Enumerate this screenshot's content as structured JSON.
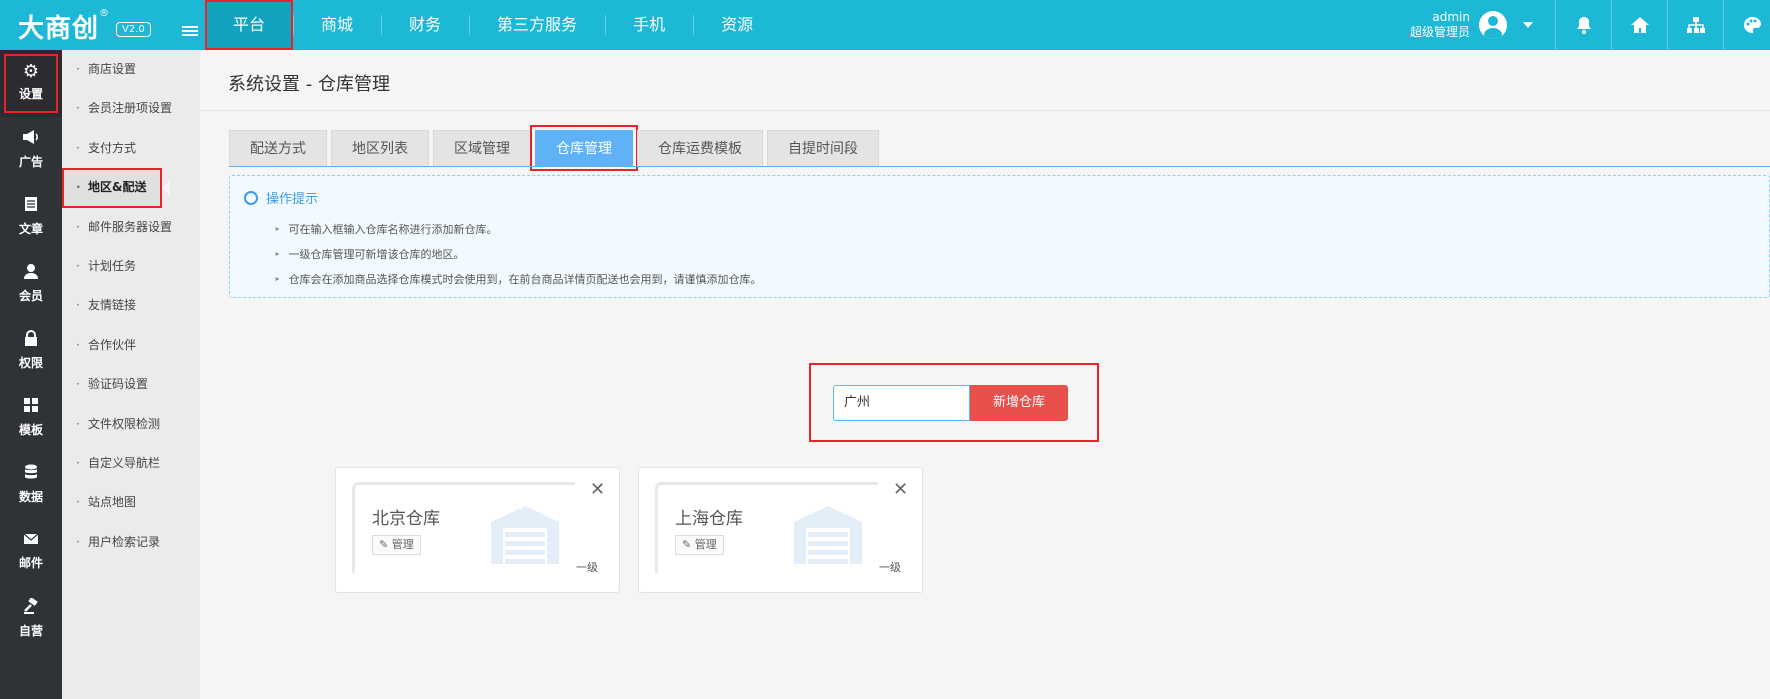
{
  "brand": {
    "logo": "大商创",
    "reg": "®",
    "version": "V2.0"
  },
  "topnav": [
    "平台",
    "商城",
    "财务",
    "第三方服务",
    "手机",
    "资源"
  ],
  "user": {
    "name": "admin",
    "role": "超级管理员"
  },
  "sidebar_icons": [
    {
      "label": "设置",
      "icon": "gear-icon"
    },
    {
      "label": "广告",
      "icon": "megaphone-icon"
    },
    {
      "label": "文章",
      "icon": "file-icon"
    },
    {
      "label": "会员",
      "icon": "user-icon"
    },
    {
      "label": "权限",
      "icon": "lock-icon"
    },
    {
      "label": "模板",
      "icon": "grid-icon"
    },
    {
      "label": "数据",
      "icon": "database-icon"
    },
    {
      "label": "邮件",
      "icon": "envelope-icon"
    },
    {
      "label": "自营",
      "icon": "gavel-icon"
    }
  ],
  "submenu": [
    "商店设置",
    "会员注册项设置",
    "支付方式",
    "地区&配送",
    "邮件服务器设置",
    "计划任务",
    "友情链接",
    "合作伙伴",
    "验证码设置",
    "文件权限检测",
    "自定义导航栏",
    "站点地图",
    "用户检索记录"
  ],
  "page_title": "系统设置 - 仓库管理",
  "tabs": [
    "配送方式",
    "地区列表",
    "区域管理",
    "仓库管理",
    "仓库运费模板",
    "自提时间段"
  ],
  "tips": {
    "title": "操作提示",
    "items": [
      "可在输入框输入仓库名称进行添加新仓库。",
      "一级仓库管理可新增该仓库的地区。",
      "仓库会在添加商品选择仓库模式时会使用到，在前台商品详情页配送也会用到，请谨慎添加仓库。"
    ]
  },
  "add": {
    "value": "广州",
    "button": "新增仓库"
  },
  "warehouses": [
    {
      "name": "北京仓库",
      "manage": "管理",
      "level": "一级"
    },
    {
      "name": "上海仓库",
      "manage": "管理",
      "level": "一级"
    }
  ],
  "colors": {
    "topbar": "#1cb8d6",
    "accent": "#5fb2f5",
    "danger": "#e9504c",
    "highlight": "#e8242a"
  }
}
